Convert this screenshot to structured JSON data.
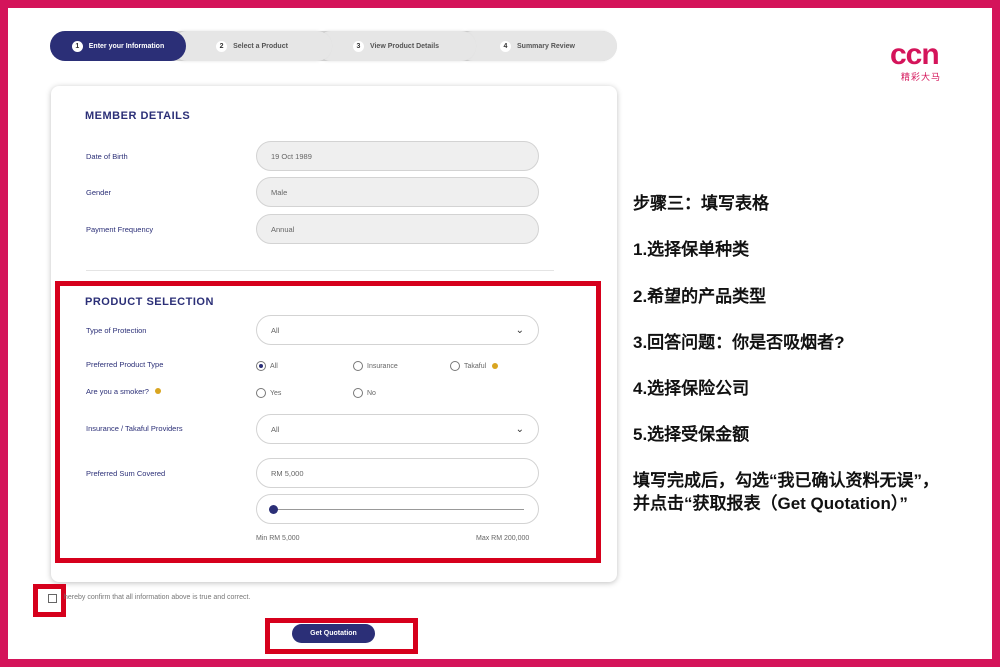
{
  "stepper": {
    "steps": [
      {
        "num": "1",
        "label": "Enter your Information"
      },
      {
        "num": "2",
        "label": "Select a Product"
      },
      {
        "num": "3",
        "label": "View Product Details"
      },
      {
        "num": "4",
        "label": "Summary Review"
      }
    ],
    "active_step": 1
  },
  "member_details": {
    "title": "MEMBER DETAILS",
    "dob_label": "Date of Birth",
    "dob_value": "19 Oct 1989",
    "gender_label": "Gender",
    "gender_value": "Male",
    "payment_label": "Payment Frequency",
    "payment_value": "Annual"
  },
  "product_selection": {
    "title": "PRODUCT SELECTION",
    "protection_label": "Type of Protection",
    "protection_value": "All",
    "product_type_label": "Preferred Product Type",
    "product_type_options": [
      "All",
      "Insurance",
      "Takaful"
    ],
    "product_type_selected": "All",
    "smoker_label": "Are you a smoker?",
    "smoker_options": [
      "Yes",
      "No"
    ],
    "providers_label": "Insurance / Takaful Providers",
    "providers_value": "All",
    "sum_label": "Preferred Sum Covered",
    "sum_value": "RM 5,000",
    "slider_level": 0,
    "min_label": "Min RM 5,000",
    "max_label": "Max RM 200,000"
  },
  "confirm": {
    "text": "hereby confirm that all information above is true and correct.",
    "checked": false
  },
  "submit_label": "Get Quotation",
  "logo": {
    "brand": "ccn",
    "sub": "精彩大马"
  },
  "instructions": {
    "heading": "步骤三：填写表格",
    "items": [
      "1.选择保单种类",
      "2.希望的产品类型",
      "3.回答问题：你是否吸烟者?",
      "4.选择保险公司",
      "5.选择受保金额"
    ],
    "final_line1": "填写完成后，勾选“我已确认资料无误”，",
    "final_line2": "并点击“获取报表（Get Quotation）”"
  },
  "colors": {
    "frame": "#d4145a",
    "primary": "#2b2f77",
    "highlight": "#d6001c"
  }
}
